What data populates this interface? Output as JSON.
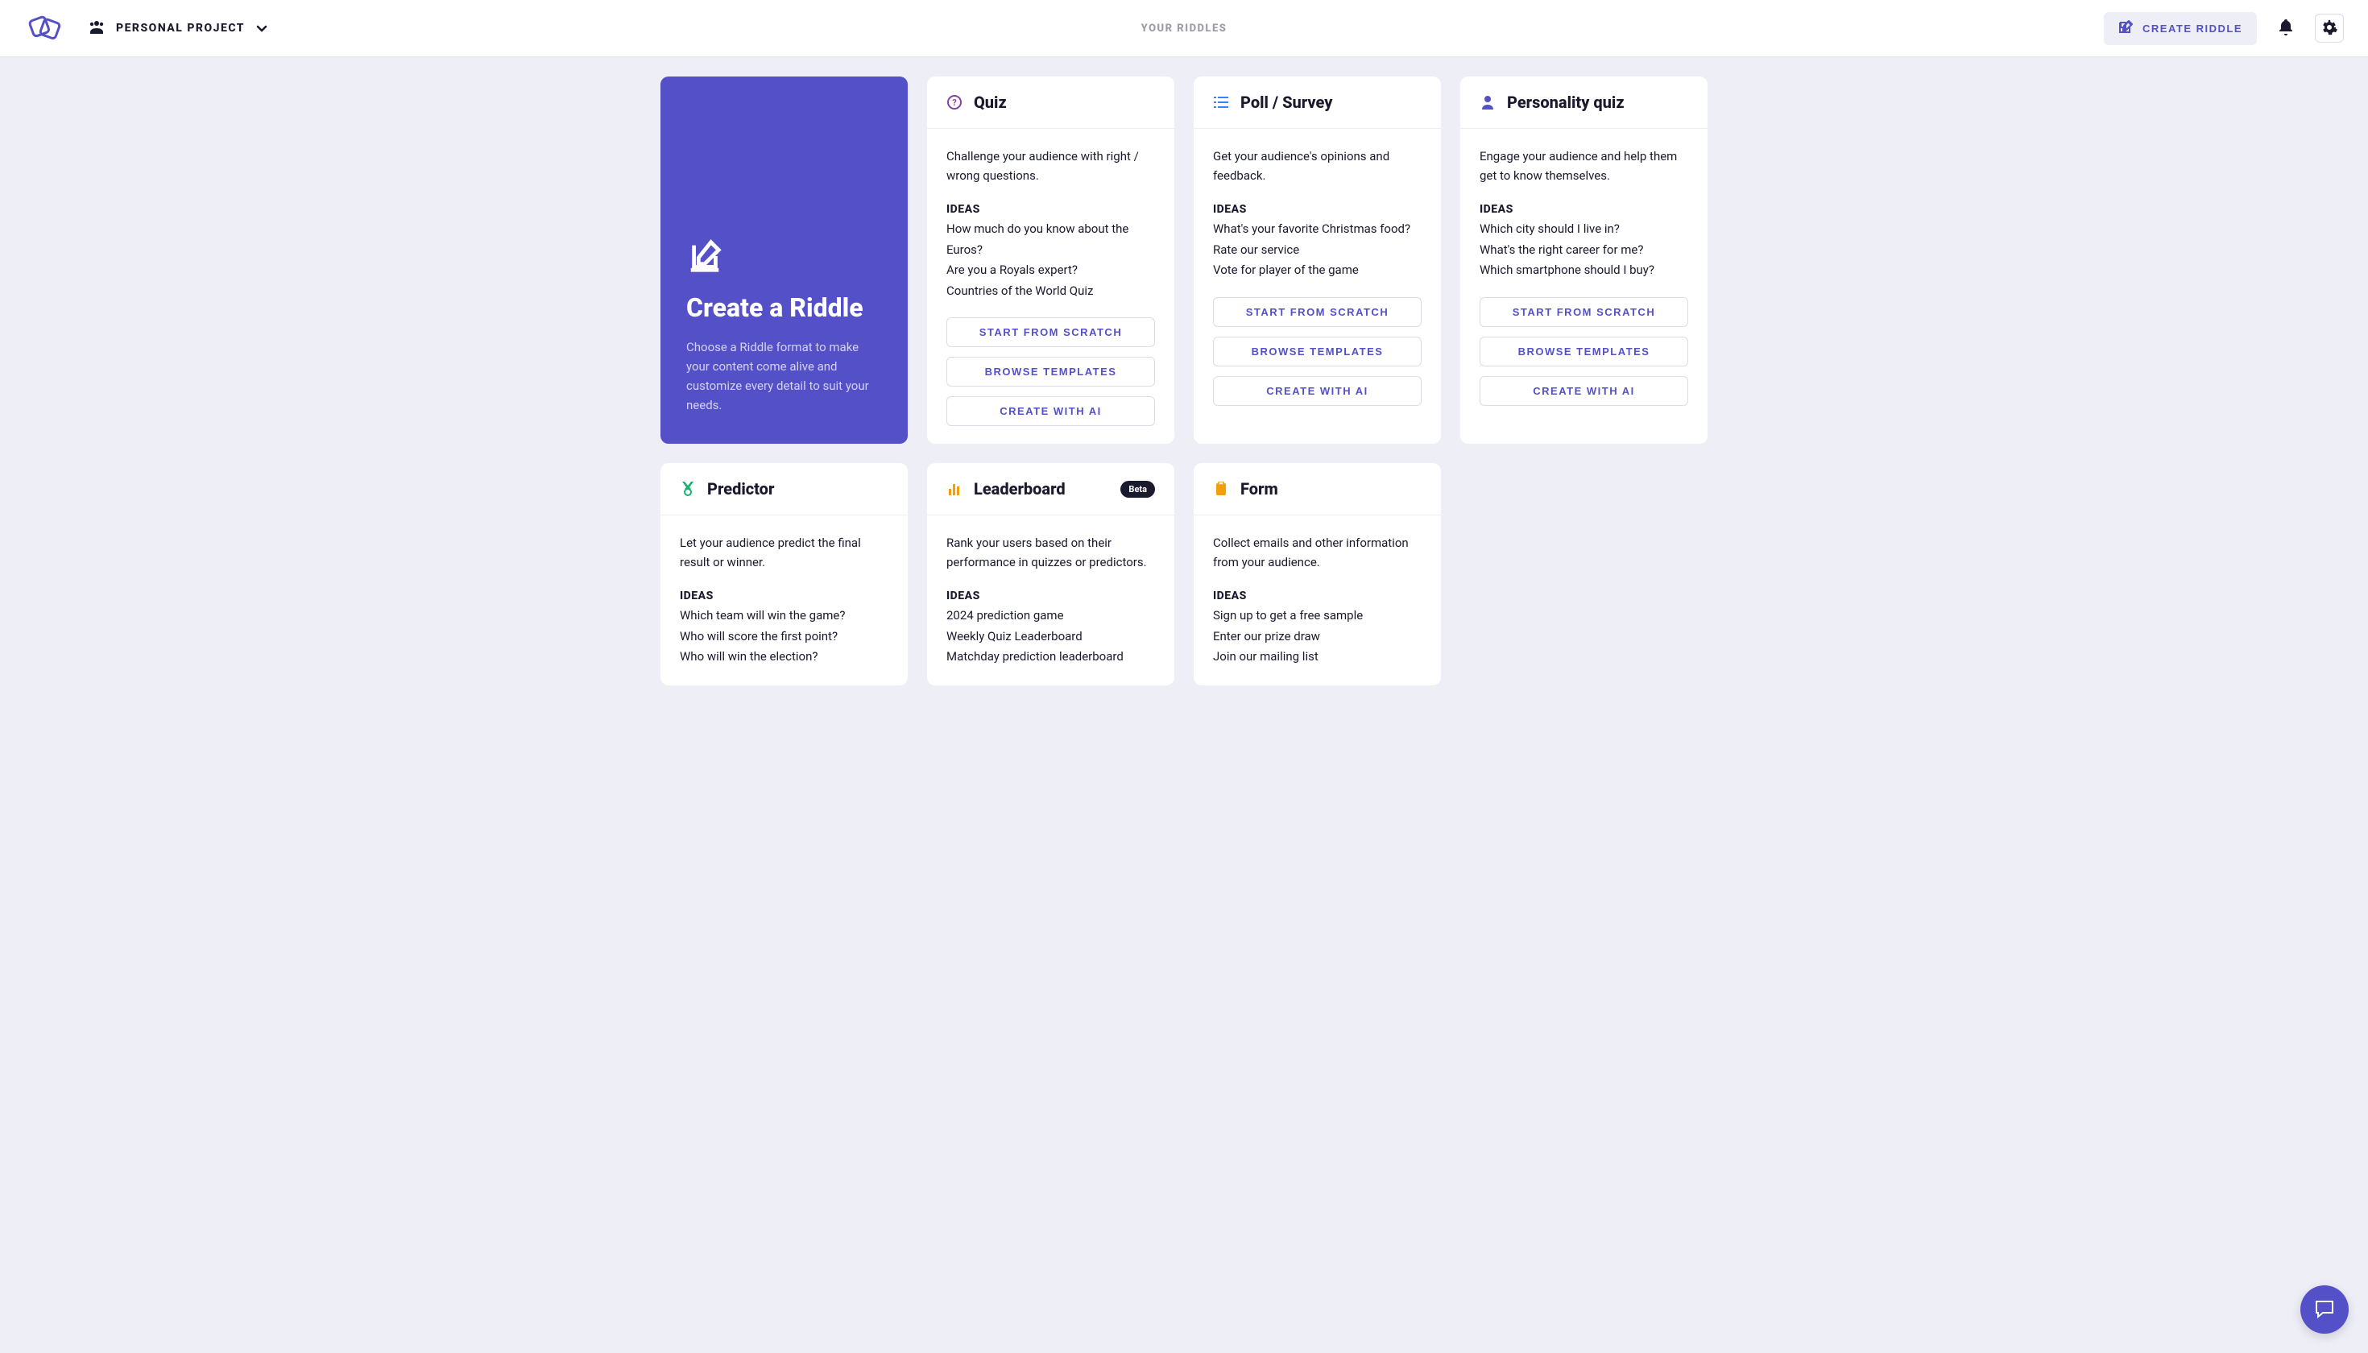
{
  "topbar": {
    "project_label": "PERSONAL PROJECT",
    "center_label": "YOUR RIDDLES",
    "create_label": "CREATE RIDDLE"
  },
  "hero": {
    "title": "Create a Riddle",
    "desc": "Choose a Riddle format to make your content come alive and customize every detail to suit your needs."
  },
  "ideas_label": "IDEAS",
  "actions": {
    "scratch": "START FROM SCRATCH",
    "templates": "BROWSE TEMPLATES",
    "ai": "CREATE WITH AI"
  },
  "cards": {
    "quiz": {
      "title": "Quiz",
      "desc": "Challenge your audience with right / wrong questions.",
      "ideas": [
        "How much do you know about the Euros?",
        "Are you a Royals expert?",
        "Countries of the World Quiz"
      ]
    },
    "poll": {
      "title": "Poll / Survey",
      "desc": "Get your audience's opinions and feedback.",
      "ideas": [
        "What's your favorite Christmas food?",
        "Rate our service",
        "Vote for player of the game"
      ]
    },
    "personality": {
      "title": "Personality quiz",
      "desc": "Engage your audience and help them get to know themselves.",
      "ideas": [
        "Which city should I live in?",
        "What's the right career for me?",
        "Which smartphone should I buy?"
      ]
    },
    "predictor": {
      "title": "Predictor",
      "desc": "Let your audience predict the final result or winner.",
      "ideas": [
        "Which team will win the game?",
        "Who will score the first point?",
        "Who will win the election?"
      ]
    },
    "leaderboard": {
      "title": "Leaderboard",
      "badge": "Beta",
      "desc": "Rank your users based on their performance in quizzes or predictors.",
      "ideas": [
        "2024 prediction game",
        "Weekly Quiz Leaderboard",
        "Matchday prediction leaderboard"
      ]
    },
    "form": {
      "title": "Form",
      "desc": "Collect emails and other information from your audience.",
      "ideas": [
        "Sign up to get a free sample",
        "Enter our prize draw",
        "Join our mailing list"
      ]
    }
  }
}
